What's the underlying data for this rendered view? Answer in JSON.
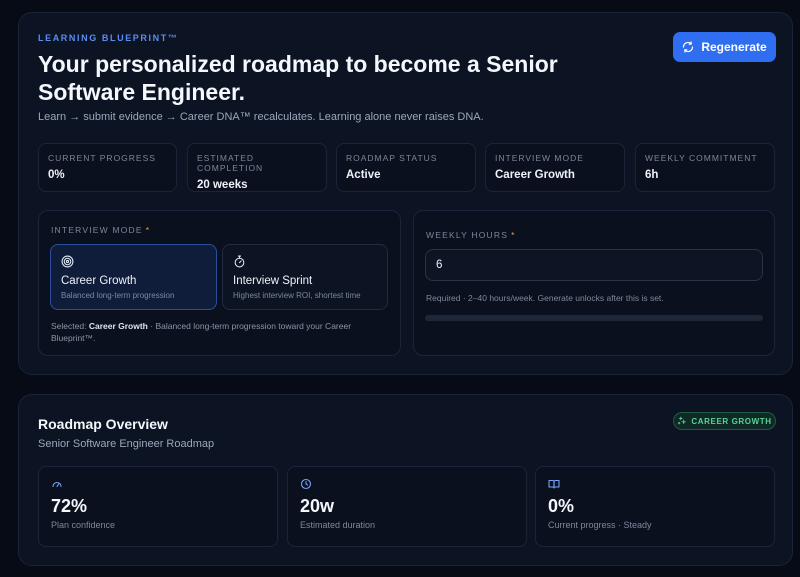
{
  "header": {
    "eyebrow": "LEARNING BLUEPRINT™",
    "title": "Your personalized roadmap to become a Senior Software Engineer.",
    "subtitle": "Learn → submit evidence → Career DNA™ recalculates. Learning alone never raises DNA.",
    "regenerate_label": "Regenerate"
  },
  "stats": [
    {
      "label": "CURRENT PROGRESS",
      "value": "0%"
    },
    {
      "label": "ESTIMATED COMPLETION",
      "value": "20 weeks"
    },
    {
      "label": "ROADMAP STATUS",
      "value": "Active"
    },
    {
      "label": "INTERVIEW MODE",
      "value": "Career Growth"
    },
    {
      "label": "WEEKLY COMMITMENT",
      "value": "6h"
    }
  ],
  "interview_mode": {
    "label": "INTERVIEW MODE",
    "required_mark": "*",
    "options": [
      {
        "title": "Career Growth",
        "desc": "Balanced long-term progression",
        "icon": "target-icon",
        "selected": true
      },
      {
        "title": "Interview Sprint",
        "desc": "Highest interview ROI, shortest time",
        "icon": "stopwatch-icon",
        "selected": false
      }
    ],
    "selected_prefix": "Selected:",
    "selected_name": "Career Growth",
    "selected_suffix": "· Balanced long-term progression toward your Career Blueprint™."
  },
  "weekly_hours": {
    "label": "WEEKLY HOURS",
    "required_mark": "*",
    "value": "6",
    "hint": "Required · 2–40 hours/week. Generate unlocks after this is set.",
    "progress_fraction": 0
  },
  "overview": {
    "title": "Roadmap Overview",
    "subtitle": "Senior Software Engineer Roadmap",
    "badge": "CAREER GROWTH",
    "metrics": [
      {
        "icon": "gauge-icon",
        "value": "72%",
        "label": "Plan confidence"
      },
      {
        "icon": "clock-icon",
        "value": "20w",
        "label": "Estimated duration"
      },
      {
        "icon": "book-icon",
        "value": "0%",
        "label": "Current progress · Steady"
      }
    ]
  },
  "colors": {
    "accent": "#2f6df1",
    "badge_green": "#56d39b",
    "required": "#f2a33a"
  }
}
